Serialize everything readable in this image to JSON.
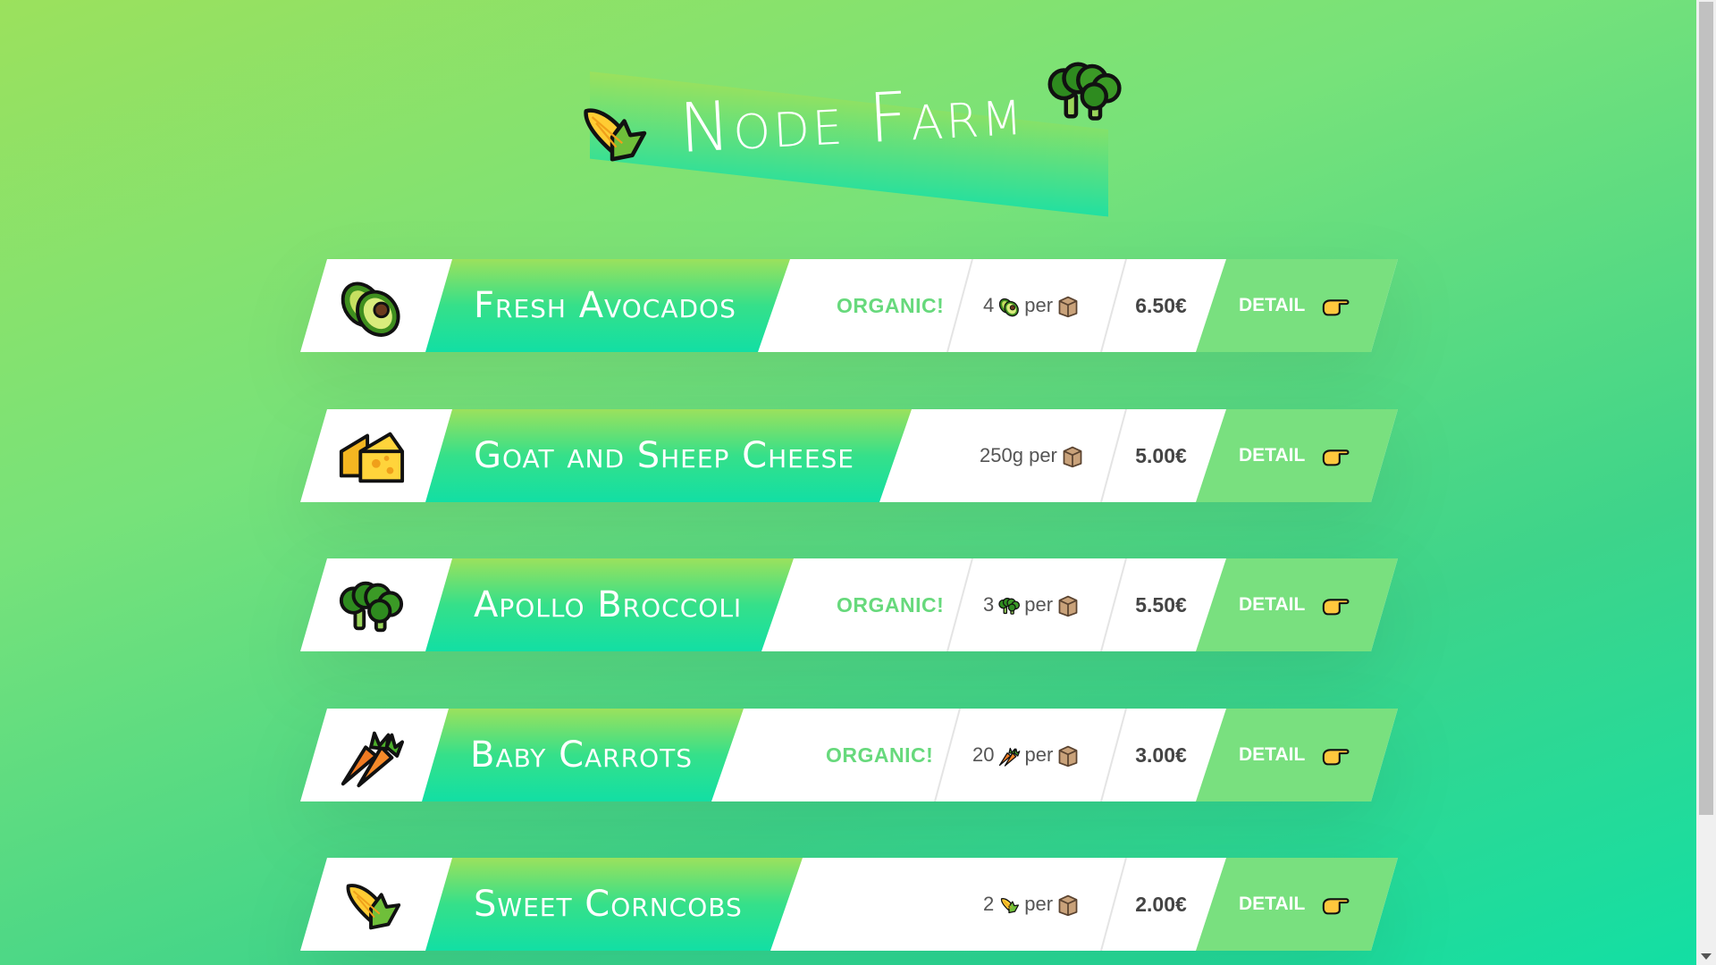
{
  "header": {
    "title": "Node Farm",
    "left_icon": "corn-icon",
    "right_icon": "broccoli-icon"
  },
  "colors": {
    "accent_green": "#67d97c",
    "gradient_start": "#9be15d",
    "gradient_end": "#12dfa4",
    "price_text": "#444444"
  },
  "products": [
    {
      "name": "Fresh Avocados",
      "icon": "avocado-icon",
      "organic": "ORGANIC!",
      "quantity": "4",
      "per": "per",
      "price": "6.50€",
      "detail": "DETAIL"
    },
    {
      "name": "Goat and Sheep Cheese",
      "icon": "cheese-icon",
      "organic": "",
      "quantity": "250g",
      "per": "per",
      "price": "5.00€",
      "detail": "DETAIL"
    },
    {
      "name": "Apollo Broccoli",
      "icon": "broccoli-icon",
      "organic": "ORGANIC!",
      "quantity": "3",
      "per": "per",
      "price": "5.50€",
      "detail": "DETAIL"
    },
    {
      "name": "Baby Carrots",
      "icon": "carrot-icon",
      "organic": "ORGANIC!",
      "quantity": "20",
      "per": "per",
      "price": "3.00€",
      "detail": "DETAIL"
    },
    {
      "name": "Sweet Corncobs",
      "icon": "corn-icon",
      "organic": "",
      "quantity": "2",
      "per": "per",
      "price": "2.00€",
      "detail": "DETAIL"
    }
  ]
}
